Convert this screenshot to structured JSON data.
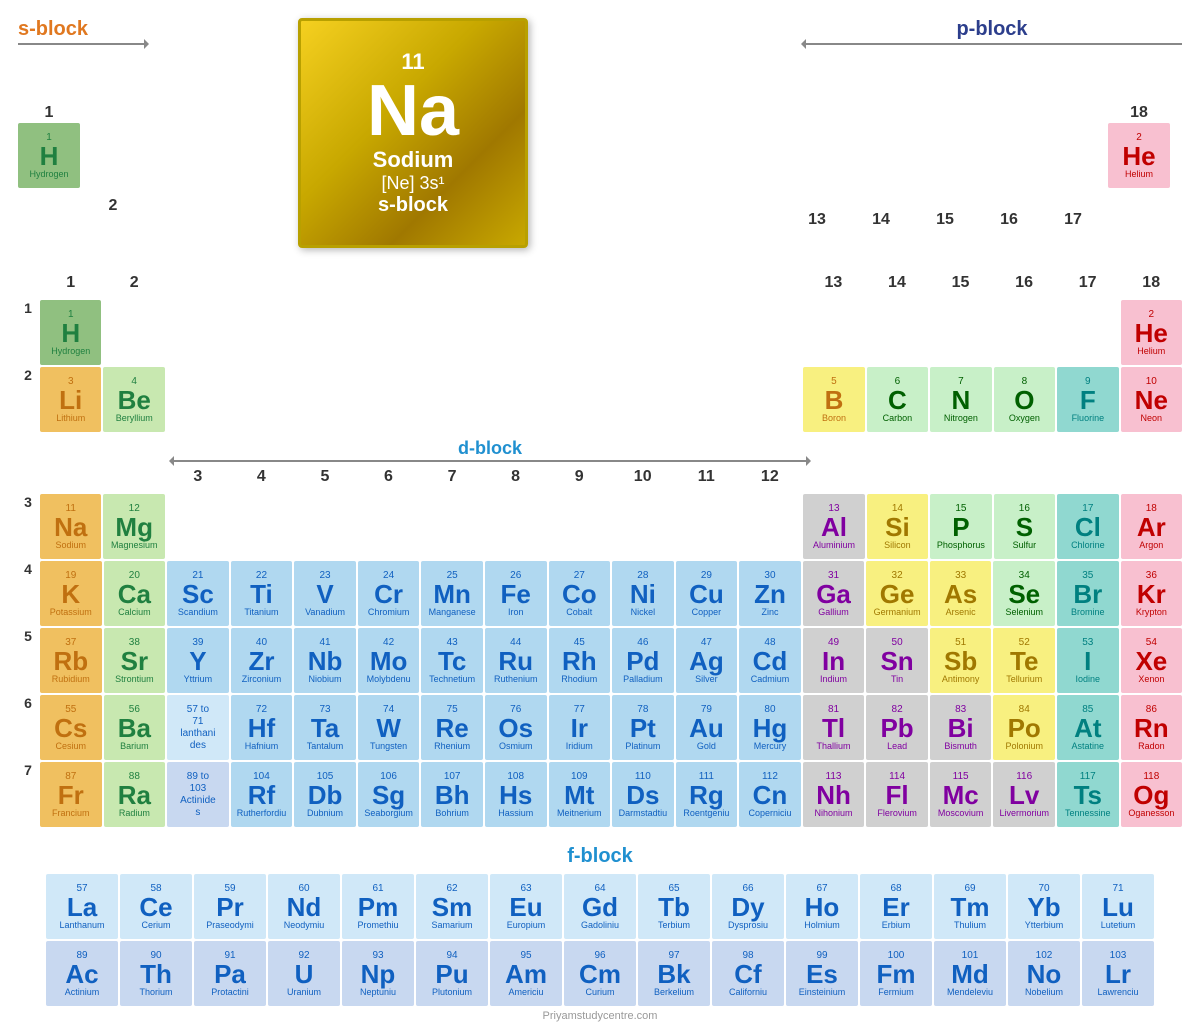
{
  "featured": {
    "atomic_number": "11",
    "symbol": "Na",
    "name": "Sodium",
    "config": "[Ne] 3s¹",
    "block": "s-block"
  },
  "blocks": {
    "s_label": "s-block",
    "d_label": "d-block",
    "p_label": "p-block",
    "f_label": "f-block"
  },
  "group_numbers": [
    "1",
    "2",
    "",
    "",
    "",
    "",
    "",
    "",
    "",
    "",
    "",
    "",
    "13",
    "14",
    "15",
    "16",
    "17",
    "18"
  ],
  "period_numbers": [
    "1",
    "2",
    "3",
    "4",
    "5",
    "6",
    "7"
  ],
  "website": "Priyamstudycentre.com",
  "elements": {
    "H": {
      "num": "1",
      "sym": "H",
      "name": "Hydrogen",
      "color": "cell-H",
      "tc": "tc-green"
    },
    "He": {
      "num": "2",
      "sym": "He",
      "name": "Helium",
      "color": "cell-noble",
      "tc": "tc-red"
    },
    "Li": {
      "num": "3",
      "sym": "Li",
      "name": "Lithium",
      "color": "cell-alkali",
      "tc": "tc-orange"
    },
    "Be": {
      "num": "4",
      "sym": "Be",
      "name": "Beryllium",
      "color": "cell-alkaline",
      "tc": "tc-green"
    },
    "B": {
      "num": "5",
      "sym": "B",
      "name": "Boron",
      "color": "cell-metalloid",
      "tc": "tc-orange"
    },
    "C": {
      "num": "6",
      "sym": "C",
      "name": "Carbon",
      "color": "cell-nonmetal",
      "tc": "tc-dark-green"
    },
    "N": {
      "num": "7",
      "sym": "N",
      "name": "Nitrogen",
      "color": "cell-nonmetal",
      "tc": "tc-dark-green"
    },
    "O": {
      "num": "8",
      "sym": "O",
      "name": "Oxygen",
      "color": "cell-nonmetal",
      "tc": "tc-dark-green"
    },
    "F": {
      "num": "9",
      "sym": "F",
      "name": "Fluorine",
      "color": "cell-halogen",
      "tc": "tc-teal"
    },
    "Ne": {
      "num": "10",
      "sym": "Ne",
      "name": "Neon",
      "color": "cell-noble",
      "tc": "tc-red"
    },
    "Na": {
      "num": "11",
      "sym": "Na",
      "name": "Sodium",
      "color": "cell-alkali",
      "tc": "tc-orange"
    },
    "Mg": {
      "num": "12",
      "sym": "Mg",
      "name": "Magnesium",
      "color": "cell-alkaline",
      "tc": "tc-green"
    },
    "Al": {
      "num": "13",
      "sym": "Al",
      "name": "Aluminium",
      "color": "cell-post-transition",
      "tc": "tc-purple"
    },
    "Si": {
      "num": "14",
      "sym": "Si",
      "name": "Silicon",
      "color": "cell-metalloid",
      "tc": "tc-gold"
    },
    "P": {
      "num": "15",
      "sym": "P",
      "name": "Phosphorus",
      "color": "cell-nonmetal",
      "tc": "tc-dark-green"
    },
    "S": {
      "num": "16",
      "sym": "S",
      "name": "Sulfur",
      "color": "cell-nonmetal",
      "tc": "tc-dark-green"
    },
    "Cl": {
      "num": "17",
      "sym": "Cl",
      "name": "Chlorine",
      "color": "cell-halogen",
      "tc": "tc-teal"
    },
    "Ar": {
      "num": "18",
      "sym": "Ar",
      "name": "Argon",
      "color": "cell-noble",
      "tc": "tc-red"
    },
    "K": {
      "num": "19",
      "sym": "K",
      "name": "Potassium",
      "color": "cell-alkali",
      "tc": "tc-orange"
    },
    "Ca": {
      "num": "20",
      "sym": "Ca",
      "name": "Calcium",
      "color": "cell-alkaline",
      "tc": "tc-green"
    },
    "Sc": {
      "num": "21",
      "sym": "Sc",
      "name": "Scandium",
      "color": "cell-transition",
      "tc": "tc-blue"
    },
    "Ti": {
      "num": "22",
      "sym": "Ti",
      "name": "Titanium",
      "color": "cell-transition",
      "tc": "tc-blue"
    },
    "V": {
      "num": "23",
      "sym": "V",
      "name": "Vanadium",
      "color": "cell-transition",
      "tc": "tc-blue"
    },
    "Cr": {
      "num": "24",
      "sym": "Cr",
      "name": "Chromium",
      "color": "cell-transition",
      "tc": "tc-blue"
    },
    "Mn": {
      "num": "25",
      "sym": "Mn",
      "name": "Manganese",
      "color": "cell-transition",
      "tc": "tc-blue"
    },
    "Fe": {
      "num": "26",
      "sym": "Fe",
      "name": "Iron",
      "color": "cell-transition",
      "tc": "tc-blue"
    },
    "Co": {
      "num": "27",
      "sym": "Co",
      "name": "Cobalt",
      "color": "cell-transition",
      "tc": "tc-blue"
    },
    "Ni": {
      "num": "28",
      "sym": "Ni",
      "name": "Nickel",
      "color": "cell-transition",
      "tc": "tc-blue"
    },
    "Cu": {
      "num": "29",
      "sym": "Cu",
      "name": "Copper",
      "color": "cell-transition",
      "tc": "tc-blue"
    },
    "Zn": {
      "num": "30",
      "sym": "Zn",
      "name": "Zinc",
      "color": "cell-transition",
      "tc": "tc-blue"
    },
    "Ga": {
      "num": "31",
      "sym": "Ga",
      "name": "Gallium",
      "color": "cell-post-transition",
      "tc": "tc-purple"
    },
    "Ge": {
      "num": "32",
      "sym": "Ge",
      "name": "Germanium",
      "color": "cell-metalloid",
      "tc": "tc-gold"
    },
    "As": {
      "num": "33",
      "sym": "As",
      "name": "Arsenic",
      "color": "cell-metalloid",
      "tc": "tc-gold"
    },
    "Se": {
      "num": "34",
      "sym": "Se",
      "name": "Selenium",
      "color": "cell-nonmetal",
      "tc": "tc-dark-green"
    },
    "Br": {
      "num": "35",
      "sym": "Br",
      "name": "Bromine",
      "color": "cell-halogen",
      "tc": "tc-teal"
    },
    "Kr": {
      "num": "36",
      "sym": "Kr",
      "name": "Krypton",
      "color": "cell-noble",
      "tc": "tc-red"
    },
    "Rb": {
      "num": "37",
      "sym": "Rb",
      "name": "Rubidium",
      "color": "cell-alkali",
      "tc": "tc-orange"
    },
    "Sr": {
      "num": "38",
      "sym": "Sr",
      "name": "Strontium",
      "color": "cell-alkaline",
      "tc": "tc-green"
    },
    "Y": {
      "num": "39",
      "sym": "Y",
      "name": "Yttrium",
      "color": "cell-transition",
      "tc": "tc-blue"
    },
    "Zr": {
      "num": "40",
      "sym": "Zr",
      "name": "Zirconium",
      "color": "cell-transition",
      "tc": "tc-blue"
    },
    "Nb": {
      "num": "41",
      "sym": "Nb",
      "name": "Niobium",
      "color": "cell-transition",
      "tc": "tc-blue"
    },
    "Mo": {
      "num": "42",
      "sym": "Mo",
      "name": "Molybdenu",
      "color": "cell-transition",
      "tc": "tc-blue"
    },
    "Tc": {
      "num": "43",
      "sym": "Tc",
      "name": "Technetium",
      "color": "cell-transition",
      "tc": "tc-blue"
    },
    "Ru": {
      "num": "44",
      "sym": "Ru",
      "name": "Ruthenium",
      "color": "cell-transition",
      "tc": "tc-blue"
    },
    "Rh": {
      "num": "45",
      "sym": "Rh",
      "name": "Rhodium",
      "color": "cell-transition",
      "tc": "tc-blue"
    },
    "Pd": {
      "num": "46",
      "sym": "Pd",
      "name": "Palladium",
      "color": "cell-transition",
      "tc": "tc-blue"
    },
    "Ag": {
      "num": "47",
      "sym": "Ag",
      "name": "Silver",
      "color": "cell-transition",
      "tc": "tc-blue"
    },
    "Cd": {
      "num": "48",
      "sym": "Cd",
      "name": "Cadmium",
      "color": "cell-transition",
      "tc": "tc-blue"
    },
    "In": {
      "num": "49",
      "sym": "In",
      "name": "Indium",
      "color": "cell-post-transition",
      "tc": "tc-purple"
    },
    "Sn": {
      "num": "50",
      "sym": "Sn",
      "name": "Tin",
      "color": "cell-post-transition",
      "tc": "tc-purple"
    },
    "Sb": {
      "num": "51",
      "sym": "Sb",
      "name": "Antimony",
      "color": "cell-metalloid",
      "tc": "tc-gold"
    },
    "Te": {
      "num": "52",
      "sym": "Te",
      "name": "Tellurium",
      "color": "cell-metalloid",
      "tc": "tc-gold"
    },
    "I": {
      "num": "53",
      "sym": "I",
      "name": "Iodine",
      "color": "cell-halogen",
      "tc": "tc-teal"
    },
    "Xe": {
      "num": "54",
      "sym": "Xe",
      "name": "Xenon",
      "color": "cell-noble",
      "tc": "tc-red"
    },
    "Cs": {
      "num": "55",
      "sym": "Cs",
      "name": "Cesium",
      "color": "cell-alkali",
      "tc": "tc-orange"
    },
    "Ba": {
      "num": "56",
      "sym": "Ba",
      "name": "Barium",
      "color": "cell-alkaline",
      "tc": "tc-green"
    },
    "Hf": {
      "num": "72",
      "sym": "Hf",
      "name": "Hafnium",
      "color": "cell-transition",
      "tc": "tc-blue"
    },
    "Ta": {
      "num": "73",
      "sym": "Ta",
      "name": "Tantalum",
      "color": "cell-transition",
      "tc": "tc-blue"
    },
    "W": {
      "num": "74",
      "sym": "W",
      "name": "Tungsten",
      "color": "cell-transition",
      "tc": "tc-blue"
    },
    "Re": {
      "num": "75",
      "sym": "Re",
      "name": "Rhenium",
      "color": "cell-transition",
      "tc": "tc-blue"
    },
    "Os": {
      "num": "76",
      "sym": "Os",
      "name": "Osmium",
      "color": "cell-transition",
      "tc": "tc-blue"
    },
    "Ir": {
      "num": "77",
      "sym": "Ir",
      "name": "Iridium",
      "color": "cell-transition",
      "tc": "tc-blue"
    },
    "Pt": {
      "num": "78",
      "sym": "Pt",
      "name": "Platinum",
      "color": "cell-transition",
      "tc": "tc-blue"
    },
    "Au": {
      "num": "79",
      "sym": "Au",
      "name": "Gold",
      "color": "cell-transition",
      "tc": "tc-blue"
    },
    "Hg": {
      "num": "80",
      "sym": "Hg",
      "name": "Mercury",
      "color": "cell-transition",
      "tc": "tc-blue"
    },
    "Tl": {
      "num": "81",
      "sym": "Tl",
      "name": "Thallium",
      "color": "cell-post-transition",
      "tc": "tc-purple"
    },
    "Pb": {
      "num": "82",
      "sym": "Pb",
      "name": "Lead",
      "color": "cell-post-transition",
      "tc": "tc-purple"
    },
    "Bi": {
      "num": "83",
      "sym": "Bi",
      "name": "Bismuth",
      "color": "cell-post-transition",
      "tc": "tc-purple"
    },
    "Po": {
      "num": "84",
      "sym": "Po",
      "name": "Polonium",
      "color": "cell-metalloid",
      "tc": "tc-gold"
    },
    "At": {
      "num": "85",
      "sym": "At",
      "name": "Astatine",
      "color": "cell-halogen",
      "tc": "tc-teal"
    },
    "Rn": {
      "num": "86",
      "sym": "Rn",
      "name": "Radon",
      "color": "cell-noble",
      "tc": "tc-red"
    },
    "Fr": {
      "num": "87",
      "sym": "Fr",
      "name": "Francium",
      "color": "cell-alkali",
      "tc": "tc-orange"
    },
    "Ra": {
      "num": "88",
      "sym": "Ra",
      "name": "Radium",
      "color": "cell-alkaline",
      "tc": "tc-green"
    },
    "Rf": {
      "num": "104",
      "sym": "Rf",
      "name": "Rutherfordiu",
      "color": "cell-transition",
      "tc": "tc-blue"
    },
    "Db": {
      "num": "105",
      "sym": "Db",
      "name": "Dubnium",
      "color": "cell-transition",
      "tc": "tc-blue"
    },
    "Sg": {
      "num": "106",
      "sym": "Sg",
      "name": "Seaborgium",
      "color": "cell-transition",
      "tc": "tc-blue"
    },
    "Bh": {
      "num": "107",
      "sym": "Bh",
      "name": "Bohrium",
      "color": "cell-transition",
      "tc": "tc-blue"
    },
    "Hs": {
      "num": "108",
      "sym": "Hs",
      "name": "Hassium",
      "color": "cell-transition",
      "tc": "tc-blue"
    },
    "Mt": {
      "num": "109",
      "sym": "Mt",
      "name": "Meitnerium",
      "color": "cell-transition",
      "tc": "tc-blue"
    },
    "Ds": {
      "num": "110",
      "sym": "Ds",
      "name": "Darmstadtiu",
      "color": "cell-transition",
      "tc": "tc-blue"
    },
    "Rg": {
      "num": "111",
      "sym": "Rg",
      "name": "Roentgeniu",
      "color": "cell-transition",
      "tc": "tc-blue"
    },
    "Cn": {
      "num": "112",
      "sym": "Cn",
      "name": "Coperniciu",
      "color": "cell-transition",
      "tc": "tc-blue"
    },
    "Nh": {
      "num": "113",
      "sym": "Nh",
      "name": "Nihonium",
      "color": "cell-post-transition",
      "tc": "tc-purple"
    },
    "Fl": {
      "num": "114",
      "sym": "Fl",
      "name": "Flerovium",
      "color": "cell-post-transition",
      "tc": "tc-purple"
    },
    "Mc": {
      "num": "115",
      "sym": "Mc",
      "name": "Moscovium",
      "color": "cell-post-transition",
      "tc": "tc-purple"
    },
    "Lv": {
      "num": "116",
      "sym": "Lv",
      "name": "Livermorium",
      "color": "cell-post-transition",
      "tc": "tc-purple"
    },
    "Ts": {
      "num": "117",
      "sym": "Ts",
      "name": "Tennessine",
      "color": "cell-halogen",
      "tc": "tc-teal"
    },
    "Og": {
      "num": "118",
      "sym": "Og",
      "name": "Oganesson",
      "color": "cell-noble",
      "tc": "tc-red"
    },
    "La": {
      "num": "57",
      "sym": "La",
      "name": "Lanthanum",
      "color": "cell-lanthanide",
      "tc": "tc-blue"
    },
    "Ce": {
      "num": "58",
      "sym": "Ce",
      "name": "Cerium",
      "color": "cell-lanthanide",
      "tc": "tc-blue"
    },
    "Pr": {
      "num": "59",
      "sym": "Pr",
      "name": "Praseodymi",
      "color": "cell-lanthanide",
      "tc": "tc-blue"
    },
    "Nd": {
      "num": "60",
      "sym": "Nd",
      "name": "Neodymiu",
      "color": "cell-lanthanide",
      "tc": "tc-blue"
    },
    "Pm": {
      "num": "61",
      "sym": "Pm",
      "name": "Promethiu",
      "color": "cell-lanthanide",
      "tc": "tc-blue"
    },
    "Sm": {
      "num": "62",
      "sym": "Sm",
      "name": "Samarium",
      "color": "cell-lanthanide",
      "tc": "tc-blue"
    },
    "Eu": {
      "num": "63",
      "sym": "Eu",
      "name": "Europium",
      "color": "cell-lanthanide",
      "tc": "tc-blue"
    },
    "Gd": {
      "num": "64",
      "sym": "Gd",
      "name": "Gadoliniu",
      "color": "cell-lanthanide",
      "tc": "tc-blue"
    },
    "Tb": {
      "num": "65",
      "sym": "Tb",
      "name": "Terbium",
      "color": "cell-lanthanide",
      "tc": "tc-blue"
    },
    "Dy": {
      "num": "66",
      "sym": "Dy",
      "name": "Dysprosiu",
      "color": "cell-lanthanide",
      "tc": "tc-blue"
    },
    "Ho": {
      "num": "67",
      "sym": "Ho",
      "name": "Holmium",
      "color": "cell-lanthanide",
      "tc": "tc-blue"
    },
    "Er": {
      "num": "68",
      "sym": "Er",
      "name": "Erbium",
      "color": "cell-lanthanide",
      "tc": "tc-blue"
    },
    "Tm": {
      "num": "69",
      "sym": "Tm",
      "name": "Thulium",
      "color": "cell-lanthanide",
      "tc": "tc-blue"
    },
    "Yb": {
      "num": "70",
      "sym": "Yb",
      "name": "Ytterbium",
      "color": "cell-lanthanide",
      "tc": "tc-blue"
    },
    "Lu": {
      "num": "71",
      "sym": "Lu",
      "name": "Lutetium",
      "color": "cell-lanthanide",
      "tc": "tc-blue"
    },
    "Ac": {
      "num": "89",
      "sym": "Ac",
      "name": "Actinium",
      "color": "cell-actinide",
      "tc": "tc-blue"
    },
    "Th": {
      "num": "90",
      "sym": "Th",
      "name": "Thorium",
      "color": "cell-actinide",
      "tc": "tc-blue"
    },
    "Pa": {
      "num": "91",
      "sym": "Pa",
      "name": "Protactini",
      "color": "cell-actinide",
      "tc": "tc-blue"
    },
    "U": {
      "num": "92",
      "sym": "U",
      "name": "Uranium",
      "color": "cell-actinide",
      "tc": "tc-blue"
    },
    "Np": {
      "num": "93",
      "sym": "Np",
      "name": "Neptuniu",
      "color": "cell-actinide",
      "tc": "tc-blue"
    },
    "Pu": {
      "num": "94",
      "sym": "Pu",
      "name": "Plutonium",
      "color": "cell-actinide",
      "tc": "tc-blue"
    },
    "Am": {
      "num": "95",
      "sym": "Am",
      "name": "Americiu",
      "color": "cell-actinide",
      "tc": "tc-blue"
    },
    "Cm": {
      "num": "96",
      "sym": "Cm",
      "name": "Curium",
      "color": "cell-actinide",
      "tc": "tc-blue"
    },
    "Bk": {
      "num": "97",
      "sym": "Bk",
      "name": "Berkelium",
      "color": "cell-actinide",
      "tc": "tc-blue"
    },
    "Cf": {
      "num": "98",
      "sym": "Cf",
      "name": "Californiu",
      "color": "cell-actinide",
      "tc": "tc-blue"
    },
    "Es": {
      "num": "99",
      "sym": "Es",
      "name": "Einsteinium",
      "color": "cell-actinide",
      "tc": "tc-blue"
    },
    "Fm": {
      "num": "100",
      "sym": "Fm",
      "name": "Fermium",
      "color": "cell-actinide",
      "tc": "tc-blue"
    },
    "Md": {
      "num": "101",
      "sym": "Md",
      "name": "Mendeleviu",
      "color": "cell-actinide",
      "tc": "tc-blue"
    },
    "No": {
      "num": "102",
      "sym": "No",
      "name": "Nobelium",
      "color": "cell-actinide",
      "tc": "tc-blue"
    },
    "Lr": {
      "num": "103",
      "sym": "Lr",
      "name": "Lawrenciu",
      "color": "cell-actinide",
      "tc": "tc-blue"
    }
  }
}
